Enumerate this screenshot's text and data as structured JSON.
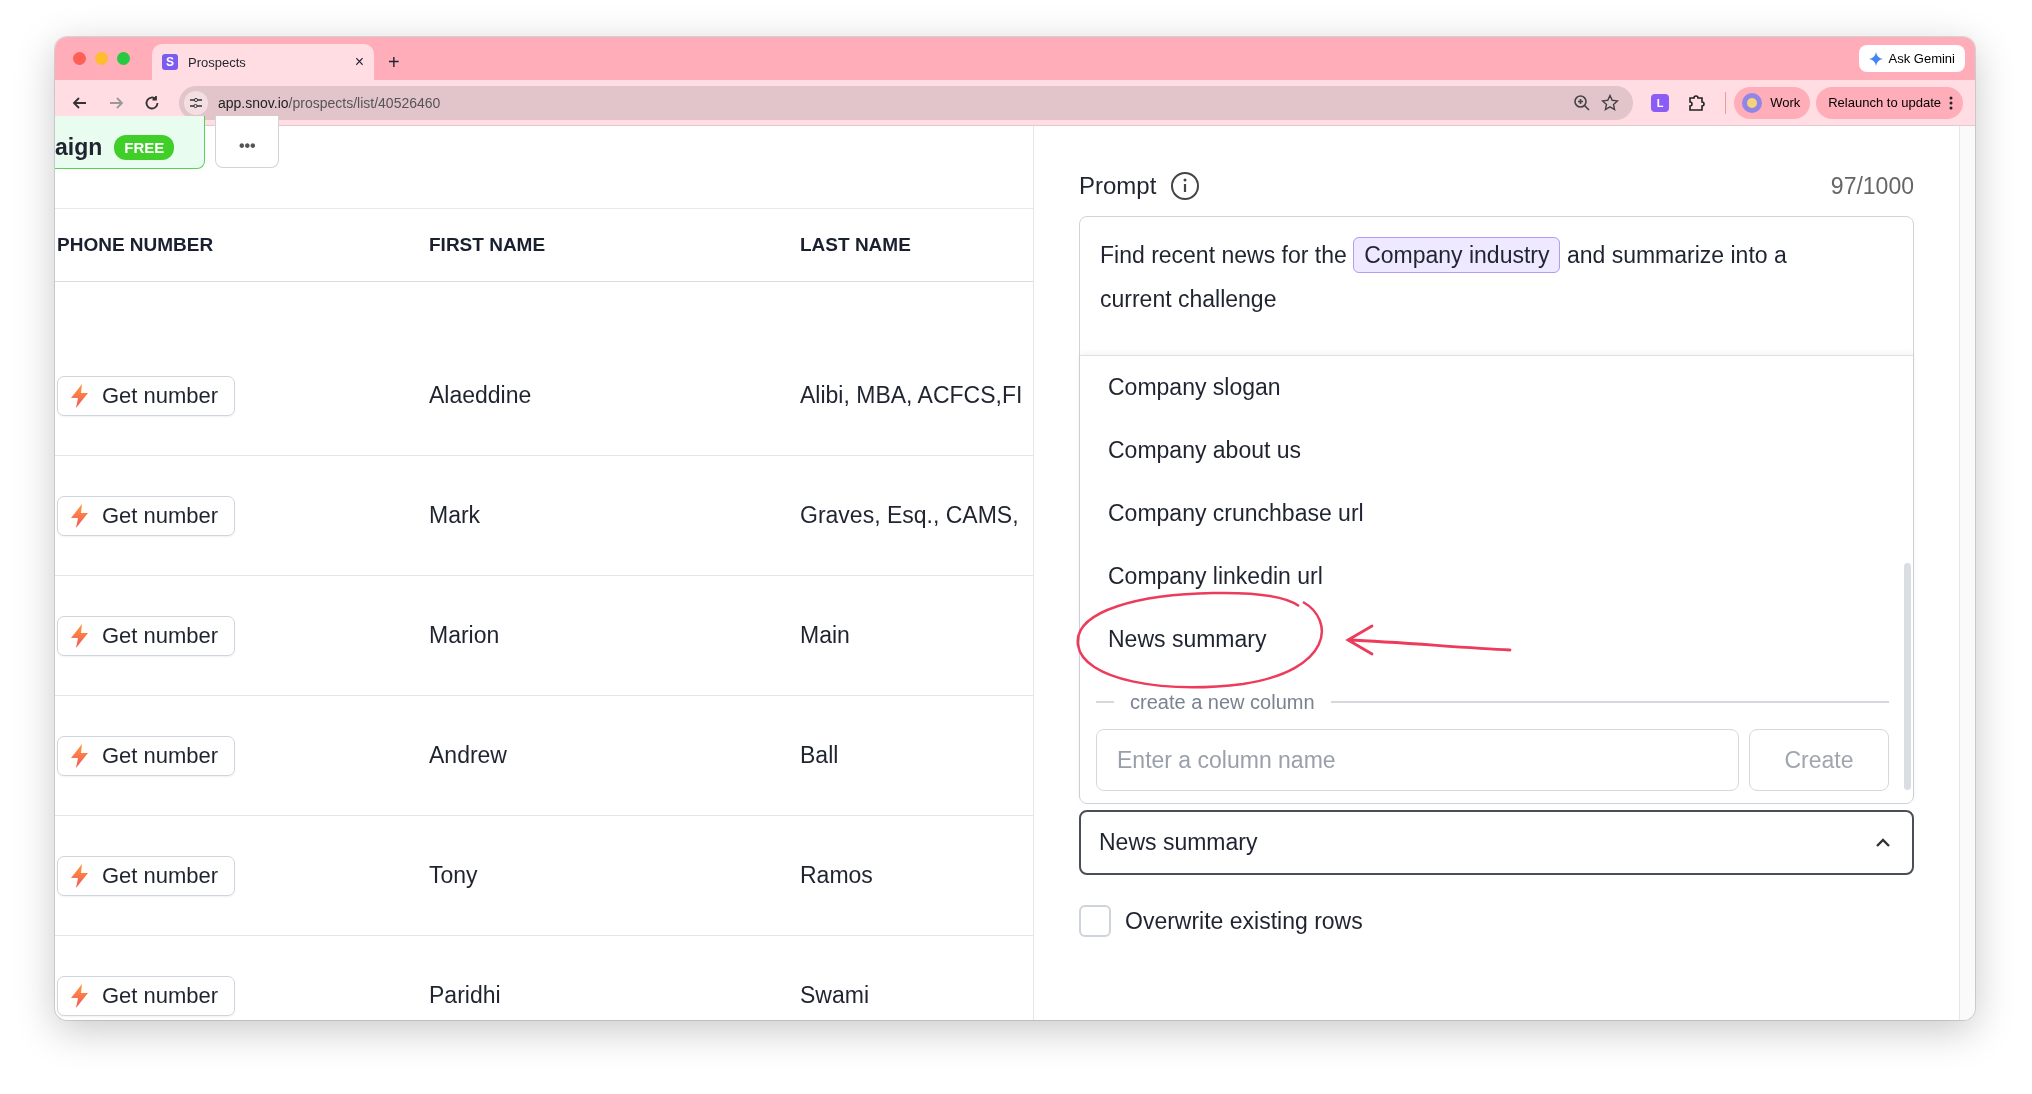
{
  "browser": {
    "tab": {
      "favicon": "S",
      "title": "Prospects",
      "close": "×"
    },
    "new_tab": "+",
    "url": {
      "host": "app.snov.io",
      "path": "/prospects/list/40526460"
    },
    "ask_gemini": "Ask Gemini",
    "extension": "L",
    "profile": "Work",
    "relaunch": "Relaunch to update"
  },
  "toolbar": {
    "campaign_button": {
      "label": "aign",
      "badge": "FREE"
    },
    "more_button": "•••"
  },
  "table": {
    "columns": [
      "PHONE NUMBER",
      "FIRST NAME",
      "LAST NAME"
    ],
    "rows": [
      {
        "action": "Get number",
        "first_name": "Alaeddine",
        "last_name": "Alibi, MBA, ACFCS,FI"
      },
      {
        "action": "Get number",
        "first_name": "Mark",
        "last_name": "Graves, Esq., CAMS,"
      },
      {
        "action": "Get number",
        "first_name": "Marion",
        "last_name": "Main"
      },
      {
        "action": "Get number",
        "first_name": "Andrew",
        "last_name": "Ball"
      },
      {
        "action": "Get number",
        "first_name": "Tony",
        "last_name": "Ramos"
      },
      {
        "action": "Get number",
        "first_name": "Paridhi",
        "last_name": "Swami"
      }
    ]
  },
  "panel": {
    "prompt_label": "Prompt",
    "counter": "97/1000",
    "prompt_text": [
      {
        "kind": "text",
        "text": "Find recent news for the"
      },
      {
        "kind": "variable",
        "text": "Company industry"
      },
      {
        "kind": "text",
        "text": "and summarize into a current challenge"
      }
    ],
    "dropdown": {
      "options": [
        "Company slogan",
        "Company about us",
        "Company crunchbase url",
        "Company linkedin url",
        "News summary"
      ],
      "create_label": "create a new column",
      "input_placeholder": "Enter a column name",
      "create_button": {
        "label": "Create",
        "disabled": true
      }
    },
    "select": {
      "value": "News summary",
      "expanded": true
    },
    "checkbox": {
      "label": "Overwrite existing rows",
      "checked": false
    }
  }
}
